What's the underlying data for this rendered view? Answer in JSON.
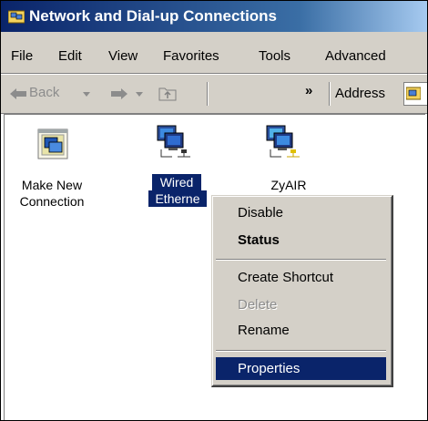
{
  "window": {
    "title": "Network and Dial-up Connections"
  },
  "menu": [
    "File",
    "Edit",
    "View",
    "Favorites",
    "Tools",
    "Advanced"
  ],
  "toolbar": {
    "back": "Back",
    "chevron": "»",
    "address": "Address"
  },
  "icons": [
    {
      "line1": "Make New",
      "line2": "Connection"
    },
    {
      "line1": "Wired",
      "line2": "Etherne"
    },
    {
      "line1": "ZyAIR",
      "line2": ""
    }
  ],
  "context_menu": {
    "items": [
      "Disable",
      "Status",
      "Create Shortcut",
      "Delete",
      "Rename",
      "Properties"
    ],
    "bold_item": "Status",
    "disabled_item": "Delete",
    "highlighted_item": "Properties"
  },
  "colors": {
    "selection": "#0a246a",
    "face": "#d4d0c8",
    "title_gradient_start": "#0a246a"
  }
}
